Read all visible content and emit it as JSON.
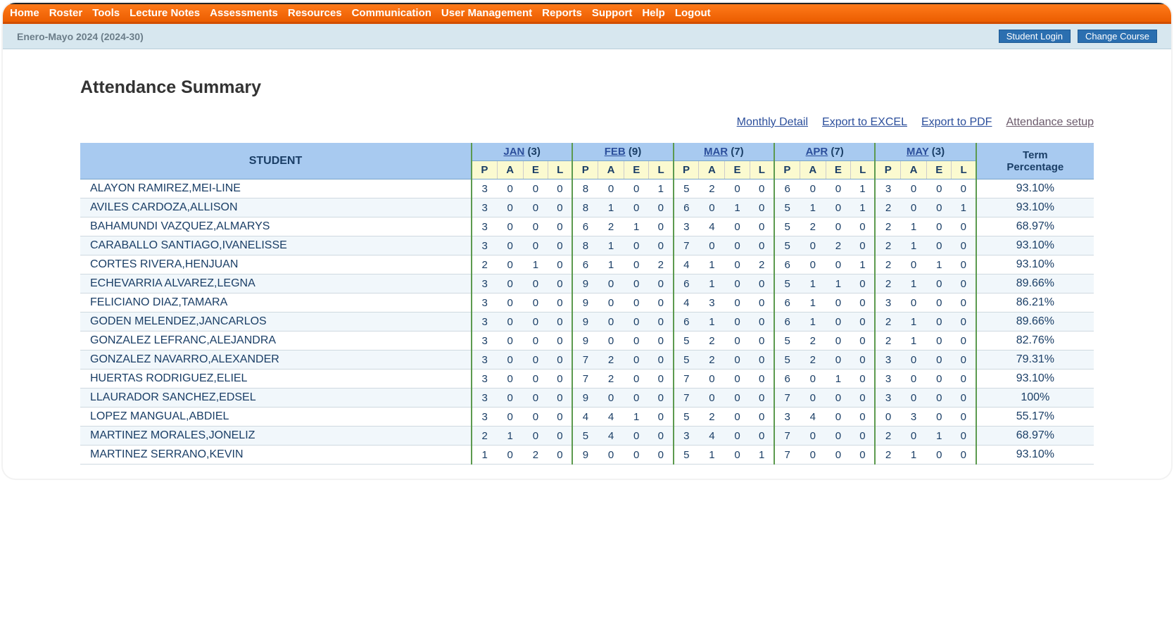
{
  "nav": {
    "items": [
      "Home",
      "Roster",
      "Tools",
      "Lecture Notes",
      "Assessments",
      "Resources",
      "Communication",
      "User Management",
      "Reports",
      "Support",
      "Help",
      "Logout"
    ]
  },
  "subbar": {
    "term": "Enero-Mayo 2024 (2024-30)",
    "student_login": "Student Login",
    "change_course": "Change Course"
  },
  "page_title": "Attendance Summary",
  "toolbar": {
    "monthly_detail": "Monthly Detail",
    "export_excel": "Export to EXCEL",
    "export_pdf": "Export to PDF",
    "attendance_setup": "Attendance setup"
  },
  "table": {
    "student_header": "STUDENT",
    "term_header": "Term Percentage",
    "pael": [
      "P",
      "A",
      "E",
      "L"
    ],
    "months": [
      {
        "label": "JAN",
        "count": 3
      },
      {
        "label": "FEB",
        "count": 9
      },
      {
        "label": "MAR",
        "count": 7
      },
      {
        "label": "APR",
        "count": 7
      },
      {
        "label": "MAY",
        "count": 3
      }
    ],
    "rows": [
      {
        "name": "ALAYON RAMIREZ,MEI-LINE",
        "m": [
          [
            3,
            0,
            0,
            0
          ],
          [
            8,
            0,
            0,
            1
          ],
          [
            5,
            2,
            0,
            0
          ],
          [
            6,
            0,
            0,
            1
          ],
          [
            3,
            0,
            0,
            0
          ]
        ],
        "pct": "93.10%"
      },
      {
        "name": "AVILES CARDOZA,ALLISON",
        "m": [
          [
            3,
            0,
            0,
            0
          ],
          [
            8,
            1,
            0,
            0
          ],
          [
            6,
            0,
            1,
            0
          ],
          [
            5,
            1,
            0,
            1
          ],
          [
            2,
            0,
            0,
            1
          ]
        ],
        "pct": "93.10%"
      },
      {
        "name": "BAHAMUNDI VAZQUEZ,ALMARYS",
        "m": [
          [
            3,
            0,
            0,
            0
          ],
          [
            6,
            2,
            1,
            0
          ],
          [
            3,
            4,
            0,
            0
          ],
          [
            5,
            2,
            0,
            0
          ],
          [
            2,
            1,
            0,
            0
          ]
        ],
        "pct": "68.97%"
      },
      {
        "name": "CARABALLO SANTIAGO,IVANELISSE",
        "m": [
          [
            3,
            0,
            0,
            0
          ],
          [
            8,
            1,
            0,
            0
          ],
          [
            7,
            0,
            0,
            0
          ],
          [
            5,
            0,
            2,
            0
          ],
          [
            2,
            1,
            0,
            0
          ]
        ],
        "pct": "93.10%"
      },
      {
        "name": "CORTES RIVERA,HENJUAN",
        "m": [
          [
            2,
            0,
            1,
            0
          ],
          [
            6,
            1,
            0,
            2
          ],
          [
            4,
            1,
            0,
            2
          ],
          [
            6,
            0,
            0,
            1
          ],
          [
            2,
            0,
            1,
            0
          ]
        ],
        "pct": "93.10%"
      },
      {
        "name": "ECHEVARRIA ALVAREZ,LEGNA",
        "m": [
          [
            3,
            0,
            0,
            0
          ],
          [
            9,
            0,
            0,
            0
          ],
          [
            6,
            1,
            0,
            0
          ],
          [
            5,
            1,
            1,
            0
          ],
          [
            2,
            1,
            0,
            0
          ]
        ],
        "pct": "89.66%"
      },
      {
        "name": "FELICIANO DIAZ,TAMARA",
        "m": [
          [
            3,
            0,
            0,
            0
          ],
          [
            9,
            0,
            0,
            0
          ],
          [
            4,
            3,
            0,
            0
          ],
          [
            6,
            1,
            0,
            0
          ],
          [
            3,
            0,
            0,
            0
          ]
        ],
        "pct": "86.21%"
      },
      {
        "name": "GODEN MELENDEZ,JANCARLOS",
        "m": [
          [
            3,
            0,
            0,
            0
          ],
          [
            9,
            0,
            0,
            0
          ],
          [
            6,
            1,
            0,
            0
          ],
          [
            6,
            1,
            0,
            0
          ],
          [
            2,
            1,
            0,
            0
          ]
        ],
        "pct": "89.66%"
      },
      {
        "name": "GONZALEZ LEFRANC,ALEJANDRA",
        "m": [
          [
            3,
            0,
            0,
            0
          ],
          [
            9,
            0,
            0,
            0
          ],
          [
            5,
            2,
            0,
            0
          ],
          [
            5,
            2,
            0,
            0
          ],
          [
            2,
            1,
            0,
            0
          ]
        ],
        "pct": "82.76%"
      },
      {
        "name": "GONZALEZ NAVARRO,ALEXANDER",
        "m": [
          [
            3,
            0,
            0,
            0
          ],
          [
            7,
            2,
            0,
            0
          ],
          [
            5,
            2,
            0,
            0
          ],
          [
            5,
            2,
            0,
            0
          ],
          [
            3,
            0,
            0,
            0
          ]
        ],
        "pct": "79.31%"
      },
      {
        "name": "HUERTAS RODRIGUEZ,ELIEL",
        "m": [
          [
            3,
            0,
            0,
            0
          ],
          [
            7,
            2,
            0,
            0
          ],
          [
            7,
            0,
            0,
            0
          ],
          [
            6,
            0,
            1,
            0
          ],
          [
            3,
            0,
            0,
            0
          ]
        ],
        "pct": "93.10%"
      },
      {
        "name": "LLAURADOR SANCHEZ,EDSEL",
        "m": [
          [
            3,
            0,
            0,
            0
          ],
          [
            9,
            0,
            0,
            0
          ],
          [
            7,
            0,
            0,
            0
          ],
          [
            7,
            0,
            0,
            0
          ],
          [
            3,
            0,
            0,
            0
          ]
        ],
        "pct": "100%"
      },
      {
        "name": "LOPEZ MANGUAL,ABDIEL",
        "m": [
          [
            3,
            0,
            0,
            0
          ],
          [
            4,
            4,
            1,
            0
          ],
          [
            5,
            2,
            0,
            0
          ],
          [
            3,
            4,
            0,
            0
          ],
          [
            0,
            3,
            0,
            0
          ]
        ],
        "pct": "55.17%"
      },
      {
        "name": "MARTINEZ MORALES,JONELIZ",
        "m": [
          [
            2,
            1,
            0,
            0
          ],
          [
            5,
            4,
            0,
            0
          ],
          [
            3,
            4,
            0,
            0
          ],
          [
            7,
            0,
            0,
            0
          ],
          [
            2,
            0,
            1,
            0
          ]
        ],
        "pct": "68.97%"
      },
      {
        "name": "MARTINEZ SERRANO,KEVIN",
        "m": [
          [
            1,
            0,
            2,
            0
          ],
          [
            9,
            0,
            0,
            0
          ],
          [
            5,
            1,
            0,
            1
          ],
          [
            7,
            0,
            0,
            0
          ],
          [
            2,
            1,
            0,
            0
          ]
        ],
        "pct": "93.10%"
      }
    ]
  }
}
